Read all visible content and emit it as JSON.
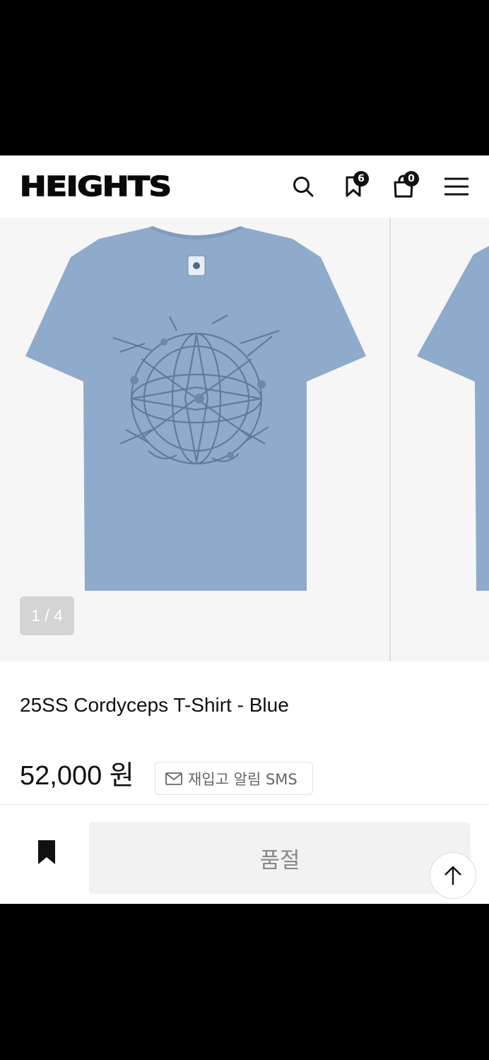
{
  "header": {
    "logo": "HEIGHTS",
    "wishlist_count": "6",
    "cart_count": "0"
  },
  "gallery": {
    "counter": "1 / 4",
    "shirt_color": "#8fabcb"
  },
  "product": {
    "title": "25SS Cordyceps T-Shirt - Blue",
    "price": "52,000 원",
    "restock_button": "재입고 알림 SMS"
  },
  "purchase": {
    "soldout_label": "품절"
  }
}
